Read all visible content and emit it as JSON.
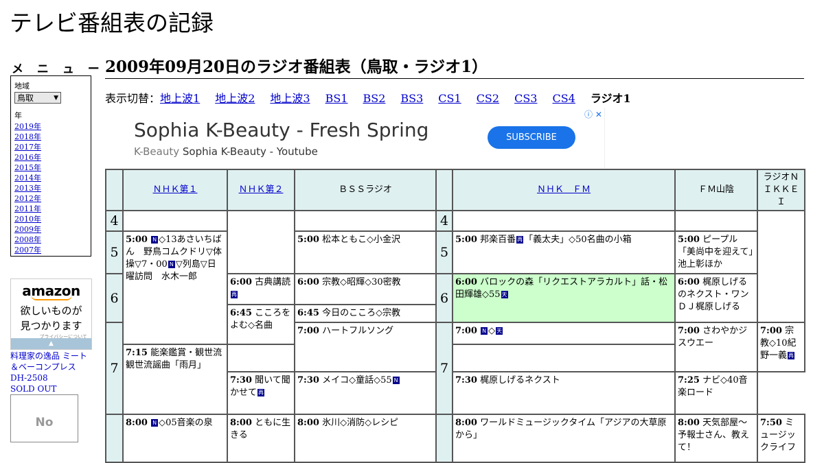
{
  "site_title": "テレビ番組表の記録",
  "menu": {
    "heading": "メ ニ ュ ー",
    "region_label": "地域",
    "region_value": "鳥取",
    "year_label": "年",
    "years": [
      "2019年",
      "2018年",
      "2017年",
      "2016年",
      "2015年",
      "2014年",
      "2013年",
      "2012年",
      "2011年",
      "2010年",
      "2009年",
      "2008年",
      "2007年"
    ]
  },
  "amazon_ad": {
    "logo": "amazon",
    "tagline1": "欲しいものが",
    "tagline2": "見つかります",
    "privacy": "プライバシーについて",
    "arrow": "▲"
  },
  "product": {
    "line1": "料理家の逸品 ミート",
    "line2": "＆ベーコンプレス",
    "line3": "DH-2508",
    "line4": "SOLD OUT",
    "noimage": "No"
  },
  "page_heading": "2009年09月20日のラジオ番組表（鳥取・ラジオ1）",
  "switcher": {
    "label": "表示切替：",
    "links": [
      "地上波1",
      "地上波2",
      "地上波3",
      "BS1",
      "BS2",
      "BS3",
      "CS1",
      "CS2",
      "CS3",
      "CS4"
    ],
    "current": "ラジオ1"
  },
  "ad": {
    "title": "Sophia K-Beauty - Fresh Spring",
    "sub_brand": "K-Beauty",
    "sub_text": "Sophia K-Beauty - Youtube",
    "button": "SUBSCRIBE",
    "choices": "ⓘ ✕"
  },
  "stations": [
    "ＮＨＫ第１",
    "ＮＨＫ第２",
    "ＢＳＳラジオ",
    "ＮＨＫ　ＦＭ",
    "ＦＭ山陰",
    "ラジオＮＩＫＫＥＩ"
  ],
  "hours": [
    "4",
    "5",
    "6",
    "7",
    "8"
  ],
  "icons": {
    "n": "N",
    "re": "再",
    "ten": "天"
  },
  "programs": {
    "nhk1_500_time": "5:00",
    "nhk1_500_a": "◇13あさいちばん　野鳥コムクドリ▽体操▽7・00",
    "nhk1_500_b": "▽列島▽日曜訪問　水木一郎",
    "nhk1_800_time": "8:00",
    "nhk1_800": "◇05音楽の泉",
    "nhk2_600_time": "6:00",
    "nhk2_600": "古典講読",
    "nhk2_645_time": "6:45",
    "nhk2_645": "こころをよむ◇名曲",
    "nhk2_730_time": "7:30",
    "nhk2_730": "聞いて聞かせて",
    "nhk2_800_time": "8:00",
    "nhk2_800": "ともに生きる",
    "bss_500_time": "5:00",
    "bss_500": "松本ともこ◇小金沢",
    "bss_600_time": "6:00",
    "bss_600": "宗教◇昭輝◇30密教",
    "bss_645_time": "6:45",
    "bss_645": "今日のこころ◇宗教",
    "bss_700_time": "7:00",
    "bss_700": "ハートフルソング",
    "bss_730_time": "7:30",
    "bss_730": "メイコ◇童話◇55",
    "bss_800_time": "8:00",
    "bss_800": "氷川◇消防◇レシピ",
    "fm_500_time": "5:00",
    "fm_500_a": "邦楽百番",
    "fm_500_b": "「義太夫」◇50名曲の小箱",
    "fm_600_time": "6:00",
    "fm_600": "バロックの森「リクエストアラカルト」話・松田輝雄◇55",
    "fm_700_time": "7:00",
    "fm_700": "◇",
    "fm_715_time": "7:15",
    "fm_715": "能楽鑑賞・観世流観世流謡曲「雨月」",
    "fm_800_time": "8:00",
    "fm_800": "ワールドミュージックタイム「アジアの大草原から」",
    "san_500_time": "5:00",
    "san_500": "ピープル「美尚中を迎えて」池上彰ほか",
    "san_600_time": "6:00",
    "san_600": "梶原しげるのネクスト・ワンＤＪ梶原しげる",
    "san_700_time": "7:00",
    "san_700": "さわやかジスウエー",
    "san_730_time": "7:30",
    "san_730": "梶原しげるネクスト",
    "san_800_time": "8:00",
    "san_800": "天気部屋～予報士さん、教えて！",
    "nik_700_time": "7:00",
    "nik_700": "宗教◇10紀野一義",
    "nik_725_time": "7:25",
    "nik_725": "ナビ◇40音楽ロード",
    "nik_750_time": "7:50",
    "nik_750": "ミュージックライフ"
  }
}
